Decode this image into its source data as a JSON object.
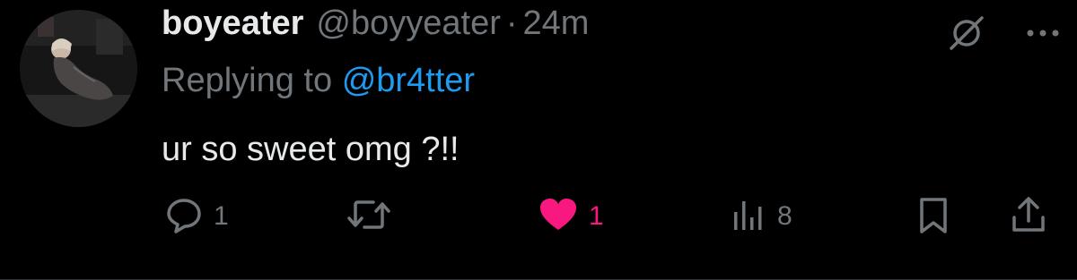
{
  "tweet": {
    "display_name": "boyeater",
    "handle": "@boyyeater",
    "separator": "·",
    "time": "24m",
    "replying_prefix": "Replying to",
    "replying_handle": "@br4tter",
    "text": "ur so sweet omg ?!!"
  },
  "actions": {
    "reply_count": "1",
    "repost_count": "",
    "like_count": "1",
    "views_count": "8"
  },
  "icons": {
    "grok": "grok-slash-icon",
    "more": "more-dots-icon",
    "reply": "reply-icon",
    "repost": "repost-icon",
    "like": "heart-filled-icon",
    "views": "views-bar-chart-icon",
    "bookmark": "bookmark-icon",
    "share": "share-upload-icon"
  },
  "colors": {
    "background": "#000000",
    "text_primary": "#e7e9ea",
    "text_secondary": "#71767b",
    "link": "#1d9bf0",
    "like": "#f91880"
  }
}
